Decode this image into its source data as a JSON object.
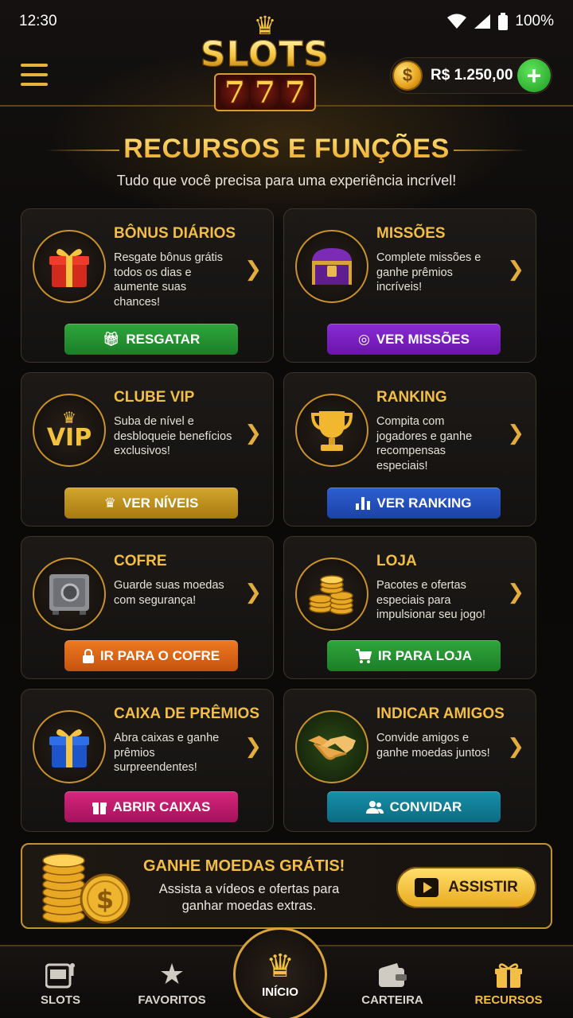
{
  "status": {
    "time": "12:30",
    "battery": "100%"
  },
  "header": {
    "logo_top": "SLOTS",
    "logo_bottom": "777",
    "balance": "R$ 1.250,00",
    "coin_symbol": "$"
  },
  "section": {
    "title": "RECURSOS E FUNÇÕES",
    "subtitle": "Tudo que você precisa para uma experiência incrível!"
  },
  "cards": [
    {
      "title": "BÔNUS DIÁRIOS",
      "desc": "Resgate bônus grátis todos os dias e aumente suas chances!",
      "button": "RESGATAR",
      "icon": "gift-icon"
    },
    {
      "title": "MISSÕES",
      "desc": "Complete missões e ganhe prêmios incríveis!",
      "button": "VER MISSÕES",
      "icon": "treasure-chest-icon"
    },
    {
      "title": "CLUBE VIP",
      "desc": "Suba de nível e desbloqueie benefícios exclusivos!",
      "button": "VER NÍVEIS",
      "icon": "vip-crown-icon",
      "icon_text": "VIP"
    },
    {
      "title": "RANKING",
      "desc": "Compita com jogadores e ganhe recompensas especiais!",
      "button": "VER RANKING",
      "icon": "trophy-icon"
    },
    {
      "title": "COFRE",
      "desc": "Guarde suas moedas com segurança!",
      "button": "IR PARA O COFRE",
      "icon": "safe-icon"
    },
    {
      "title": "LOJA",
      "desc": "Pacotes e ofertas especiais para impulsionar seu jogo!",
      "button": "IR PARA LOJA",
      "icon": "coin-stacks-icon"
    },
    {
      "title": "CAIXA DE PRÊMIOS",
      "desc": "Abra caixas e ganhe prêmios surpreendentes!",
      "button": "ABRIR CAIXAS",
      "icon": "prize-box-icon"
    },
    {
      "title": "INDICAR AMIGOS",
      "desc": "Convide amigos e ganhe moedas juntos!",
      "button": "CONVIDAR",
      "icon": "handshake-icon"
    }
  ],
  "promo": {
    "title": "GANHE MOEDAS GRÁTIS!",
    "desc": "Assista a vídeos e ofertas para ganhar moedas extras.",
    "button": "ASSISTIR"
  },
  "nav": {
    "slots": "SLOTS",
    "favorites": "FAVORITOS",
    "home": "INÍCIO",
    "wallet": "CARTEIRA",
    "resources": "RECURSOS"
  },
  "colors": {
    "accent_gold": "#f2be45",
    "background": "#0b0908",
    "green": "#2fa63b",
    "purple": "#8a2bd3",
    "blue": "#2d5fd1",
    "orange": "#ef7a22",
    "pink": "#d7267d",
    "teal": "#1690a9"
  }
}
